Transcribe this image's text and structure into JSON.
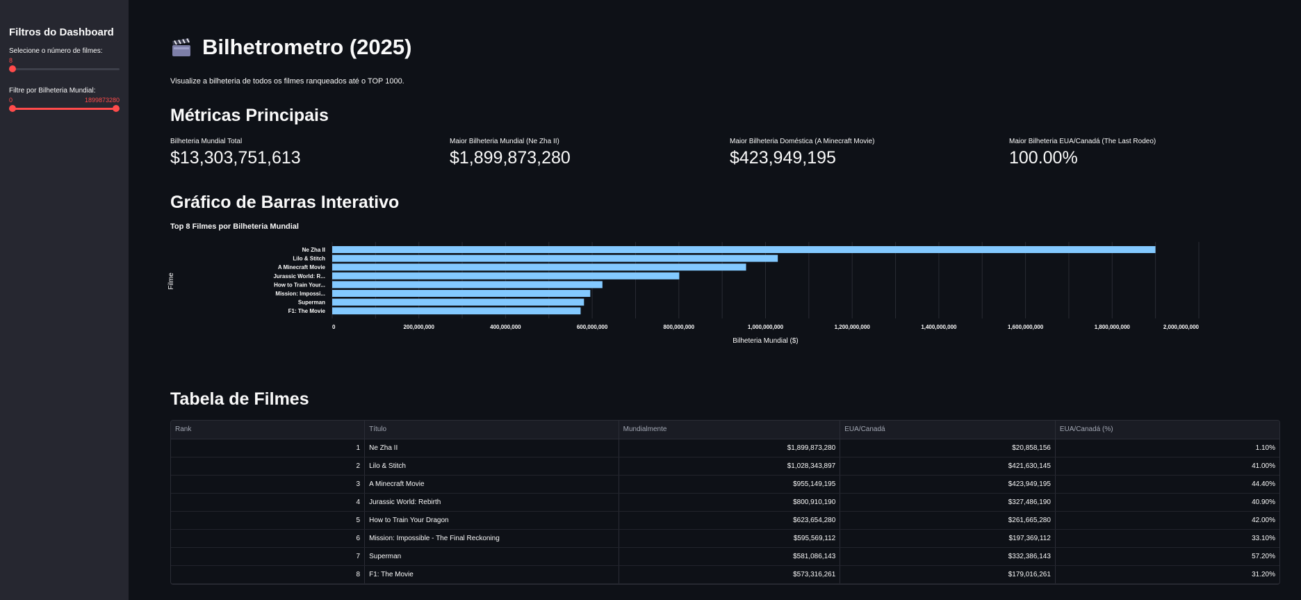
{
  "sidebar": {
    "title": "Filtros do Dashboard",
    "count_slider": {
      "label": "Selecione o número de filmes:",
      "value": "8",
      "fraction": 0.0
    },
    "gross_slider": {
      "label": "Filtre por Bilheteria Mundial:",
      "min_value": "0",
      "max_value": "1899873280",
      "low_fraction": 0.0,
      "high_fraction": 1.0
    }
  },
  "header": {
    "icon": "clapper-board-icon",
    "title": "Bilhetrometro (2025)",
    "subtitle": "Visualize a bilheteria de todos os filmes ranqueados até o TOP 1000."
  },
  "metrics_section": {
    "heading": "Métricas Principais",
    "metrics": [
      {
        "label": "Bilheteria Mundial Total",
        "value": "$13,303,751,613"
      },
      {
        "label": "Maior Bilheteria Mundial (Ne Zha II)",
        "value": "$1,899,873,280"
      },
      {
        "label": "Maior Bilheteria Doméstica (A Minecraft Movie)",
        "value": "$423,949,195"
      },
      {
        "label": "Maior Bilheteria EUA/Canadá (The Last Rodeo)",
        "value": "100.00%"
      }
    ]
  },
  "chart_section": {
    "heading": "Gráfico de Barras Interativo"
  },
  "chart_data": {
    "type": "bar",
    "orientation": "horizontal",
    "title": "Top 8 Filmes por Bilheteria Mundial",
    "xlabel": "Bilheteria Mundial ($)",
    "ylabel": "Filme",
    "categories": [
      "Ne Zha II",
      "Lilo & Stitch",
      "A Minecraft Movie",
      "Jurassic World: R...",
      "How to Train Your...",
      "Mission: Impossi...",
      "Superman",
      "F1: The Movie"
    ],
    "values": [
      1899873280,
      1028343897,
      955149195,
      800910190,
      623654280,
      595569112,
      581086143,
      573316261
    ],
    "xlim": [
      0,
      2000000000
    ],
    "xticks": [
      0,
      200000000,
      400000000,
      600000000,
      800000000,
      1000000000,
      1200000000,
      1400000000,
      1600000000,
      1800000000,
      2000000000
    ],
    "xtick_labels": [
      "0",
      "200,000,000",
      "400,000,000",
      "600,000,000",
      "800,000,000",
      "1,000,000,000",
      "1,200,000,000",
      "1,400,000,000",
      "1,600,000,000",
      "1,800,000,000",
      "2,000,000,000"
    ],
    "grid": true,
    "bar_color": "#83c9ff"
  },
  "table_section": {
    "heading": "Tabela de Filmes",
    "columns": [
      "Rank",
      "Título",
      "Mundialmente",
      "EUA/Canadá",
      "EUA/Canadá (%)"
    ],
    "rows": [
      [
        "1",
        "Ne Zha II",
        "$1,899,873,280",
        "$20,858,156",
        "1.10%"
      ],
      [
        "2",
        "Lilo & Stitch",
        "$1,028,343,897",
        "$421,630,145",
        "41.00%"
      ],
      [
        "3",
        "A Minecraft Movie",
        "$955,149,195",
        "$423,949,195",
        "44.40%"
      ],
      [
        "4",
        "Jurassic World: Rebirth",
        "$800,910,190",
        "$327,486,190",
        "40.90%"
      ],
      [
        "5",
        "How to Train Your Dragon",
        "$623,654,280",
        "$261,665,280",
        "42.00%"
      ],
      [
        "6",
        "Mission: Impossible - The Final Reckoning",
        "$595,569,112",
        "$197,369,112",
        "33.10%"
      ],
      [
        "7",
        "Superman",
        "$581,086,143",
        "$332,386,143",
        "57.20%"
      ],
      [
        "8",
        "F1: The Movie",
        "$573,316,261",
        "$179,016,261",
        "31.20%"
      ]
    ]
  },
  "colors": {
    "accent": "#ff4b4b",
    "background": "#0e1117",
    "sidebar": "#262730",
    "bar": "#83c9ff"
  }
}
